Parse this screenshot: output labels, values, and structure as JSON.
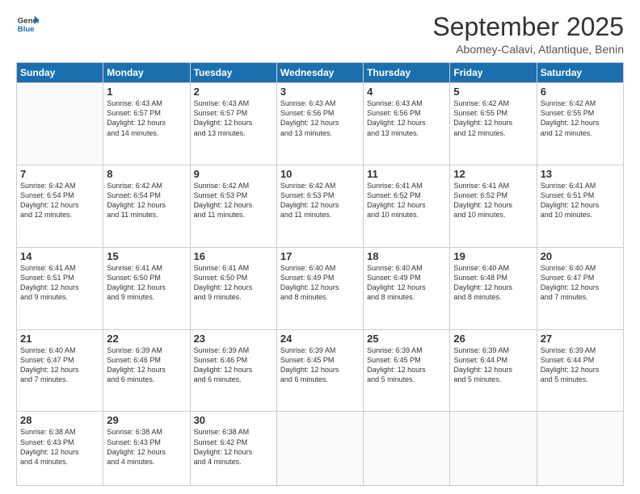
{
  "logo": {
    "line1": "General",
    "line2": "Blue"
  },
  "title": "September 2025",
  "location": "Abomey-Calavi, Atlantique, Benin",
  "weekdays": [
    "Sunday",
    "Monday",
    "Tuesday",
    "Wednesday",
    "Thursday",
    "Friday",
    "Saturday"
  ],
  "weeks": [
    [
      {
        "day": "",
        "info": ""
      },
      {
        "day": "1",
        "info": "Sunrise: 6:43 AM\nSunset: 6:57 PM\nDaylight: 12 hours\nand 14 minutes."
      },
      {
        "day": "2",
        "info": "Sunrise: 6:43 AM\nSunset: 6:57 PM\nDaylight: 12 hours\nand 13 minutes."
      },
      {
        "day": "3",
        "info": "Sunrise: 6:43 AM\nSunset: 6:56 PM\nDaylight: 12 hours\nand 13 minutes."
      },
      {
        "day": "4",
        "info": "Sunrise: 6:43 AM\nSunset: 6:56 PM\nDaylight: 12 hours\nand 13 minutes."
      },
      {
        "day": "5",
        "info": "Sunrise: 6:42 AM\nSunset: 6:55 PM\nDaylight: 12 hours\nand 12 minutes."
      },
      {
        "day": "6",
        "info": "Sunrise: 6:42 AM\nSunset: 6:55 PM\nDaylight: 12 hours\nand 12 minutes."
      }
    ],
    [
      {
        "day": "7",
        "info": "Sunrise: 6:42 AM\nSunset: 6:54 PM\nDaylight: 12 hours\nand 12 minutes."
      },
      {
        "day": "8",
        "info": "Sunrise: 6:42 AM\nSunset: 6:54 PM\nDaylight: 12 hours\nand 11 minutes."
      },
      {
        "day": "9",
        "info": "Sunrise: 6:42 AM\nSunset: 6:53 PM\nDaylight: 12 hours\nand 11 minutes."
      },
      {
        "day": "10",
        "info": "Sunrise: 6:42 AM\nSunset: 6:53 PM\nDaylight: 12 hours\nand 11 minutes."
      },
      {
        "day": "11",
        "info": "Sunrise: 6:41 AM\nSunset: 6:52 PM\nDaylight: 12 hours\nand 10 minutes."
      },
      {
        "day": "12",
        "info": "Sunrise: 6:41 AM\nSunset: 6:52 PM\nDaylight: 12 hours\nand 10 minutes."
      },
      {
        "day": "13",
        "info": "Sunrise: 6:41 AM\nSunset: 6:51 PM\nDaylight: 12 hours\nand 10 minutes."
      }
    ],
    [
      {
        "day": "14",
        "info": "Sunrise: 6:41 AM\nSunset: 6:51 PM\nDaylight: 12 hours\nand 9 minutes."
      },
      {
        "day": "15",
        "info": "Sunrise: 6:41 AM\nSunset: 6:50 PM\nDaylight: 12 hours\nand 9 minutes."
      },
      {
        "day": "16",
        "info": "Sunrise: 6:41 AM\nSunset: 6:50 PM\nDaylight: 12 hours\nand 9 minutes."
      },
      {
        "day": "17",
        "info": "Sunrise: 6:40 AM\nSunset: 6:49 PM\nDaylight: 12 hours\nand 8 minutes."
      },
      {
        "day": "18",
        "info": "Sunrise: 6:40 AM\nSunset: 6:49 PM\nDaylight: 12 hours\nand 8 minutes."
      },
      {
        "day": "19",
        "info": "Sunrise: 6:40 AM\nSunset: 6:48 PM\nDaylight: 12 hours\nand 8 minutes."
      },
      {
        "day": "20",
        "info": "Sunrise: 6:40 AM\nSunset: 6:47 PM\nDaylight: 12 hours\nand 7 minutes."
      }
    ],
    [
      {
        "day": "21",
        "info": "Sunrise: 6:40 AM\nSunset: 6:47 PM\nDaylight: 12 hours\nand 7 minutes."
      },
      {
        "day": "22",
        "info": "Sunrise: 6:39 AM\nSunset: 6:46 PM\nDaylight: 12 hours\nand 6 minutes."
      },
      {
        "day": "23",
        "info": "Sunrise: 6:39 AM\nSunset: 6:46 PM\nDaylight: 12 hours\nand 6 minutes."
      },
      {
        "day": "24",
        "info": "Sunrise: 6:39 AM\nSunset: 6:45 PM\nDaylight: 12 hours\nand 6 minutes."
      },
      {
        "day": "25",
        "info": "Sunrise: 6:39 AM\nSunset: 6:45 PM\nDaylight: 12 hours\nand 5 minutes."
      },
      {
        "day": "26",
        "info": "Sunrise: 6:39 AM\nSunset: 6:44 PM\nDaylight: 12 hours\nand 5 minutes."
      },
      {
        "day": "27",
        "info": "Sunrise: 6:39 AM\nSunset: 6:44 PM\nDaylight: 12 hours\nand 5 minutes."
      }
    ],
    [
      {
        "day": "28",
        "info": "Sunrise: 6:38 AM\nSunset: 6:43 PM\nDaylight: 12 hours\nand 4 minutes."
      },
      {
        "day": "29",
        "info": "Sunrise: 6:38 AM\nSunset: 6:43 PM\nDaylight: 12 hours\nand 4 minutes."
      },
      {
        "day": "30",
        "info": "Sunrise: 6:38 AM\nSunset: 6:42 PM\nDaylight: 12 hours\nand 4 minutes."
      },
      {
        "day": "",
        "info": ""
      },
      {
        "day": "",
        "info": ""
      },
      {
        "day": "",
        "info": ""
      },
      {
        "day": "",
        "info": ""
      }
    ]
  ]
}
